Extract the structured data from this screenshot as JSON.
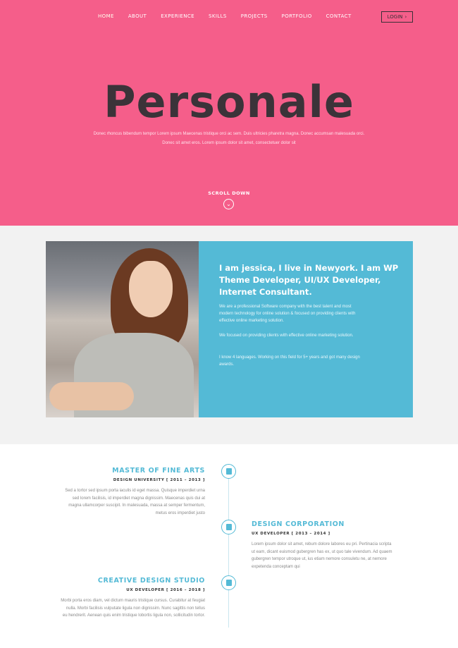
{
  "nav": {
    "items": [
      "HOME",
      "ABOUT",
      "EXPERIENCE",
      "SKILLS",
      "PROJECTS",
      "PORTFOLIO",
      "CONTACT"
    ],
    "active": "HOME",
    "login_label": "LOGIN",
    "login_icon": "chevron-right-icon"
  },
  "hero": {
    "title": "Personale",
    "subtitle": "Donec rhoncus bibendum tempor Lorem ipsum Maecenas tristique orci ac sem. Duis ultricies pharetra magna. Donec accumsan malesuada orci. Donec sit amet eros. Lorem ipsum dolor sit amet, consectetuer dolor sit",
    "scroll_label": "SCROLL DOWN",
    "scroll_icon": "chevron-down-icon",
    "bg_color": "#f55e8a"
  },
  "about": {
    "photo_alt": "portrait photo",
    "heading": "I am jessica, I live in Newyork. I am WP Theme Developer, UI/UX Developer, Internet Consultant.",
    "paragraphs": [
      "We are a professional Software company with the best talent and most modern technology for online solution & focused on providing clients with effective online marketing solution.",
      "We focused on providing clients with effective online marketing solution.",
      "I know 4 languages. Working on this field for 5+ years and got many design awards."
    ],
    "card_color": "#54bad6"
  },
  "timeline": [
    {
      "side": "left",
      "title": "MASTER OF FINE ARTS",
      "subtitle": "DESIGN UNIVERSITY [ 2011 – 2013 ]",
      "text": "Sed a tortor sed ipsum porta iaculis id eget massa. Quisque imperdiet urna sed lorem facilisis, id imperdiet magna dignissim. Maecenas quis dui at magna ullamcorper suscipit. In malesuada, massa at semper fermentum, metus eros imperdiet justo",
      "icon": "book-icon"
    },
    {
      "side": "right",
      "title": "DESIGN CORPORATION",
      "subtitle": "UX DEVELOPER [ 2013 – 2014 ]",
      "text": "Lorem ipsum dolor sit amet, rebum dolore labores eu pri. Pertinacia scripta ut eam, dicant euismod gubergren has ex, ut quo tale vivendum. Ad quaem gubergren tempor utroque ut, ius etiam nemore consuletu ne, at nemore expetenda conceptam qui",
      "icon": "briefcase-icon"
    },
    {
      "side": "left",
      "title": "CREATIVE DESIGN STUDIO",
      "subtitle": "UX DEVELOPER [ 2016 – 2018 ]",
      "text": "Morbi porta eros diam, vel dictum mauris tristique cursus. Curabitur at feugiat nulla. Morbi facilisis vulputate ligula non dignissim. Nunc sagittis non tellus eu hendrerit. Aenean quis enim tristique lobortis ligula non, sollicitudin tortor.",
      "icon": "gift-icon"
    }
  ]
}
